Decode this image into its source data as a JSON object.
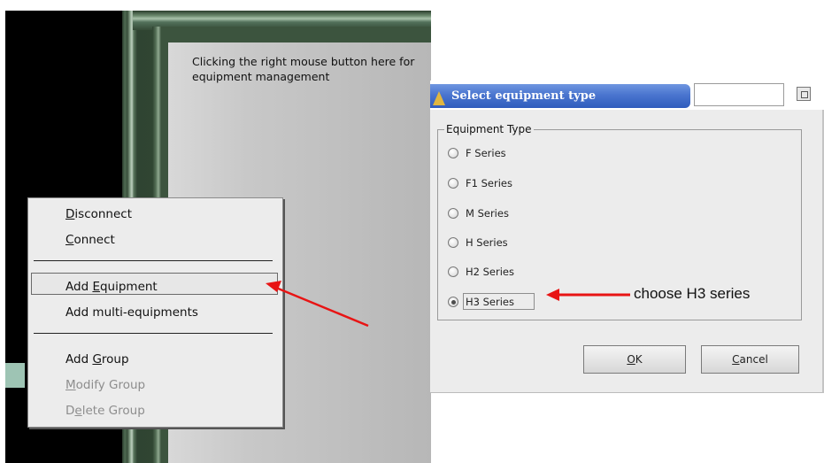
{
  "panel_hint": "Clicking the right mouse button here for equipment management",
  "context_menu": {
    "items": [
      {
        "pre": "",
        "key": "D",
        "post": "isconnect",
        "enabled": true
      },
      {
        "pre": "",
        "key": "C",
        "post": "onnect",
        "enabled": true
      },
      {
        "pre": "Add ",
        "key": "E",
        "post": "quipment",
        "enabled": true,
        "highlighted": true
      },
      {
        "pre": "Add multi-equipments",
        "key": "",
        "post": "",
        "enabled": true
      },
      {
        "pre": "Add ",
        "key": "G",
        "post": "roup",
        "enabled": true
      },
      {
        "pre": "",
        "key": "M",
        "post": "odify Group",
        "enabled": false
      },
      {
        "pre": "D",
        "key": "e",
        "post": "lete Group",
        "enabled": false
      }
    ]
  },
  "dialog": {
    "title": "Select equipment type",
    "group_label": "Equipment Type",
    "options": [
      {
        "label": "F Series",
        "selected": false
      },
      {
        "label": "F1 Series",
        "selected": false
      },
      {
        "label": "M Series",
        "selected": false
      },
      {
        "label": "H Series",
        "selected": false
      },
      {
        "label": "H2 Series",
        "selected": false
      },
      {
        "label": "H3 Series",
        "selected": true
      }
    ],
    "ok": {
      "key": "O",
      "post": "K"
    },
    "cancel": {
      "key": "C",
      "post": "ancel"
    }
  },
  "annotation": {
    "text": "choose H3 series",
    "arrow_color": "#e81414"
  },
  "colors": {
    "title_bar": "#4a75cf",
    "frame_green": "#3d563f",
    "panel_gray": "#c8c8c8"
  }
}
